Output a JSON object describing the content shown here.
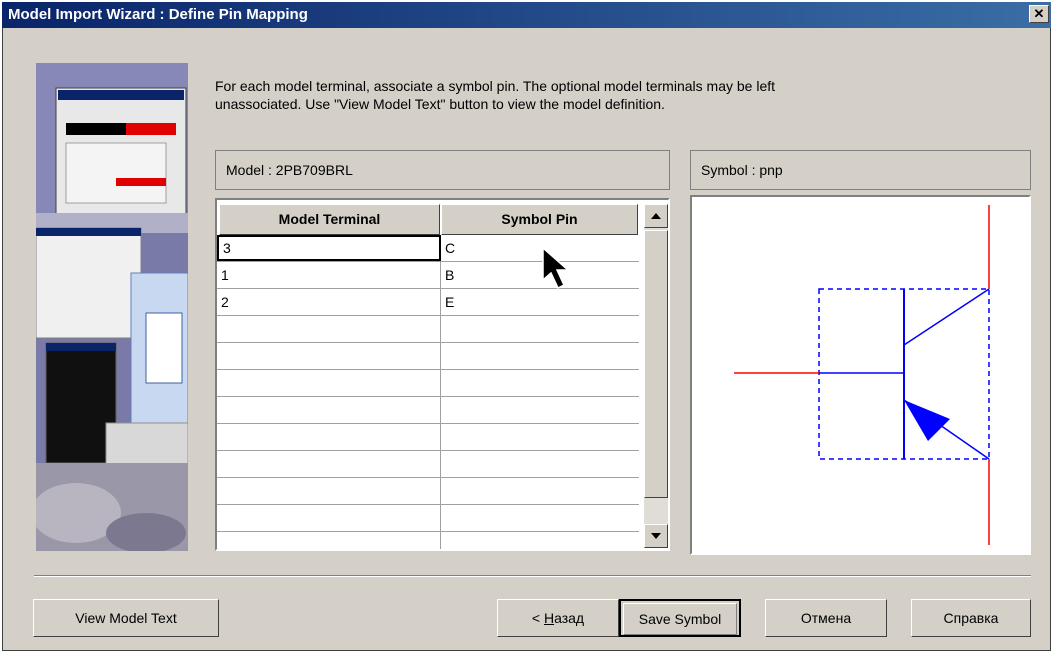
{
  "window": {
    "title": "Model Import Wizard : Define Pin Mapping",
    "close_glyph": "✕"
  },
  "instructions": {
    "line1": "For each model terminal, associate a symbol pin. The optional model terminals may be left",
    "line2": "unassociated. Use \"View Model Text\" button to view the model definition."
  },
  "model_panel": {
    "label": "Model : 2PB709BRL"
  },
  "symbol_panel": {
    "label": "Symbol : pnp"
  },
  "grid": {
    "columns": [
      "Model Terminal",
      "Symbol Pin"
    ],
    "rows": [
      [
        "3",
        "C"
      ],
      [
        "1",
        "B"
      ],
      [
        "2",
        "E"
      ],
      [
        "",
        ""
      ],
      [
        "",
        ""
      ],
      [
        "",
        ""
      ],
      [
        "",
        ""
      ],
      [
        "",
        ""
      ],
      [
        "",
        ""
      ],
      [
        "",
        ""
      ],
      [
        "",
        ""
      ],
      [
        "",
        ""
      ]
    ]
  },
  "buttons": {
    "view_model_text": "View Model Text",
    "back_prefix": "< ",
    "back_hotkey": "Н",
    "back_rest": "азад",
    "save_symbol": "Save Symbol",
    "cancel": "Отмена",
    "help": "Справка"
  },
  "colors": {
    "title_start": "#0a246a",
    "title_end": "#3a6ea5",
    "pin_red": "#ff0000",
    "symbol_blue": "#0000ff",
    "face": "#d4d0c8"
  },
  "icons": {
    "close": "close-icon",
    "scroll_up": "triangle-up-icon",
    "scroll_down": "triangle-down-icon",
    "pointer": "mouse-pointer-icon"
  }
}
